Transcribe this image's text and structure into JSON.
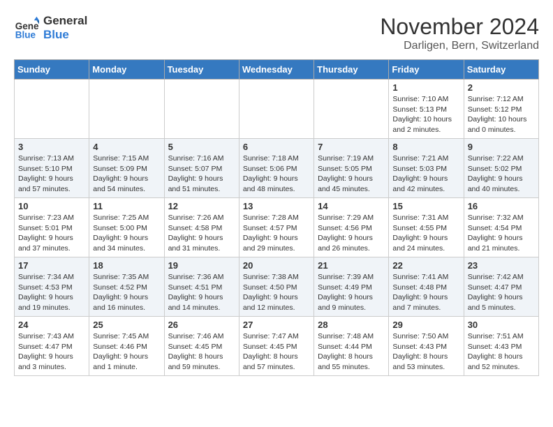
{
  "header": {
    "logo_line1": "General",
    "logo_line2": "Blue",
    "month": "November 2024",
    "location": "Darligen, Bern, Switzerland"
  },
  "weekdays": [
    "Sunday",
    "Monday",
    "Tuesday",
    "Wednesday",
    "Thursday",
    "Friday",
    "Saturday"
  ],
  "weeks": [
    [
      {
        "day": "",
        "info": ""
      },
      {
        "day": "",
        "info": ""
      },
      {
        "day": "",
        "info": ""
      },
      {
        "day": "",
        "info": ""
      },
      {
        "day": "",
        "info": ""
      },
      {
        "day": "1",
        "info": "Sunrise: 7:10 AM\nSunset: 5:13 PM\nDaylight: 10 hours\nand 2 minutes."
      },
      {
        "day": "2",
        "info": "Sunrise: 7:12 AM\nSunset: 5:12 PM\nDaylight: 10 hours\nand 0 minutes."
      }
    ],
    [
      {
        "day": "3",
        "info": "Sunrise: 7:13 AM\nSunset: 5:10 PM\nDaylight: 9 hours\nand 57 minutes."
      },
      {
        "day": "4",
        "info": "Sunrise: 7:15 AM\nSunset: 5:09 PM\nDaylight: 9 hours\nand 54 minutes."
      },
      {
        "day": "5",
        "info": "Sunrise: 7:16 AM\nSunset: 5:07 PM\nDaylight: 9 hours\nand 51 minutes."
      },
      {
        "day": "6",
        "info": "Sunrise: 7:18 AM\nSunset: 5:06 PM\nDaylight: 9 hours\nand 48 minutes."
      },
      {
        "day": "7",
        "info": "Sunrise: 7:19 AM\nSunset: 5:05 PM\nDaylight: 9 hours\nand 45 minutes."
      },
      {
        "day": "8",
        "info": "Sunrise: 7:21 AM\nSunset: 5:03 PM\nDaylight: 9 hours\nand 42 minutes."
      },
      {
        "day": "9",
        "info": "Sunrise: 7:22 AM\nSunset: 5:02 PM\nDaylight: 9 hours\nand 40 minutes."
      }
    ],
    [
      {
        "day": "10",
        "info": "Sunrise: 7:23 AM\nSunset: 5:01 PM\nDaylight: 9 hours\nand 37 minutes."
      },
      {
        "day": "11",
        "info": "Sunrise: 7:25 AM\nSunset: 5:00 PM\nDaylight: 9 hours\nand 34 minutes."
      },
      {
        "day": "12",
        "info": "Sunrise: 7:26 AM\nSunset: 4:58 PM\nDaylight: 9 hours\nand 31 minutes."
      },
      {
        "day": "13",
        "info": "Sunrise: 7:28 AM\nSunset: 4:57 PM\nDaylight: 9 hours\nand 29 minutes."
      },
      {
        "day": "14",
        "info": "Sunrise: 7:29 AM\nSunset: 4:56 PM\nDaylight: 9 hours\nand 26 minutes."
      },
      {
        "day": "15",
        "info": "Sunrise: 7:31 AM\nSunset: 4:55 PM\nDaylight: 9 hours\nand 24 minutes."
      },
      {
        "day": "16",
        "info": "Sunrise: 7:32 AM\nSunset: 4:54 PM\nDaylight: 9 hours\nand 21 minutes."
      }
    ],
    [
      {
        "day": "17",
        "info": "Sunrise: 7:34 AM\nSunset: 4:53 PM\nDaylight: 9 hours\nand 19 minutes."
      },
      {
        "day": "18",
        "info": "Sunrise: 7:35 AM\nSunset: 4:52 PM\nDaylight: 9 hours\nand 16 minutes."
      },
      {
        "day": "19",
        "info": "Sunrise: 7:36 AM\nSunset: 4:51 PM\nDaylight: 9 hours\nand 14 minutes."
      },
      {
        "day": "20",
        "info": "Sunrise: 7:38 AM\nSunset: 4:50 PM\nDaylight: 9 hours\nand 12 minutes."
      },
      {
        "day": "21",
        "info": "Sunrise: 7:39 AM\nSunset: 4:49 PM\nDaylight: 9 hours\nand 9 minutes."
      },
      {
        "day": "22",
        "info": "Sunrise: 7:41 AM\nSunset: 4:48 PM\nDaylight: 9 hours\nand 7 minutes."
      },
      {
        "day": "23",
        "info": "Sunrise: 7:42 AM\nSunset: 4:47 PM\nDaylight: 9 hours\nand 5 minutes."
      }
    ],
    [
      {
        "day": "24",
        "info": "Sunrise: 7:43 AM\nSunset: 4:47 PM\nDaylight: 9 hours\nand 3 minutes."
      },
      {
        "day": "25",
        "info": "Sunrise: 7:45 AM\nSunset: 4:46 PM\nDaylight: 9 hours\nand 1 minute."
      },
      {
        "day": "26",
        "info": "Sunrise: 7:46 AM\nSunset: 4:45 PM\nDaylight: 8 hours\nand 59 minutes."
      },
      {
        "day": "27",
        "info": "Sunrise: 7:47 AM\nSunset: 4:45 PM\nDaylight: 8 hours\nand 57 minutes."
      },
      {
        "day": "28",
        "info": "Sunrise: 7:48 AM\nSunset: 4:44 PM\nDaylight: 8 hours\nand 55 minutes."
      },
      {
        "day": "29",
        "info": "Sunrise: 7:50 AM\nSunset: 4:43 PM\nDaylight: 8 hours\nand 53 minutes."
      },
      {
        "day": "30",
        "info": "Sunrise: 7:51 AM\nSunset: 4:43 PM\nDaylight: 8 hours\nand 52 minutes."
      }
    ]
  ]
}
